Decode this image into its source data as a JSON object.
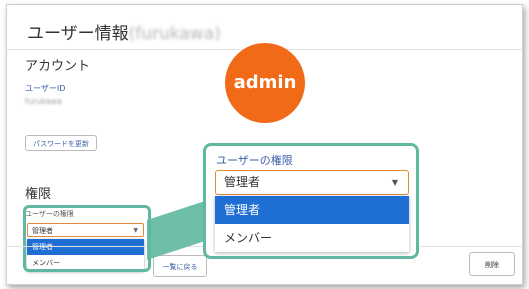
{
  "page": {
    "title": "ユーザー情報",
    "title_user": "(furukawa)"
  },
  "account": {
    "heading": "アカウント",
    "user_id_label": "ユーザーID",
    "user_id_value": "furukawa",
    "change_password_button": "パスワードを更新"
  },
  "permissions": {
    "heading": "権限",
    "field_label": "ユーザーの権限",
    "selected": "管理者",
    "options": [
      "管理者",
      "メンバー"
    ]
  },
  "footer": {
    "back_button": "一覧に戻る",
    "delete_button": "削除"
  },
  "badge": {
    "label": "admin",
    "color": "#f06a18"
  },
  "callout": {
    "field_label": "ユーザーの権限",
    "selected": "管理者",
    "options": [
      "管理者",
      "メンバー"
    ],
    "highlight_color": "#5fb89f"
  },
  "icons": {
    "dropdown": "caret-down-icon"
  }
}
